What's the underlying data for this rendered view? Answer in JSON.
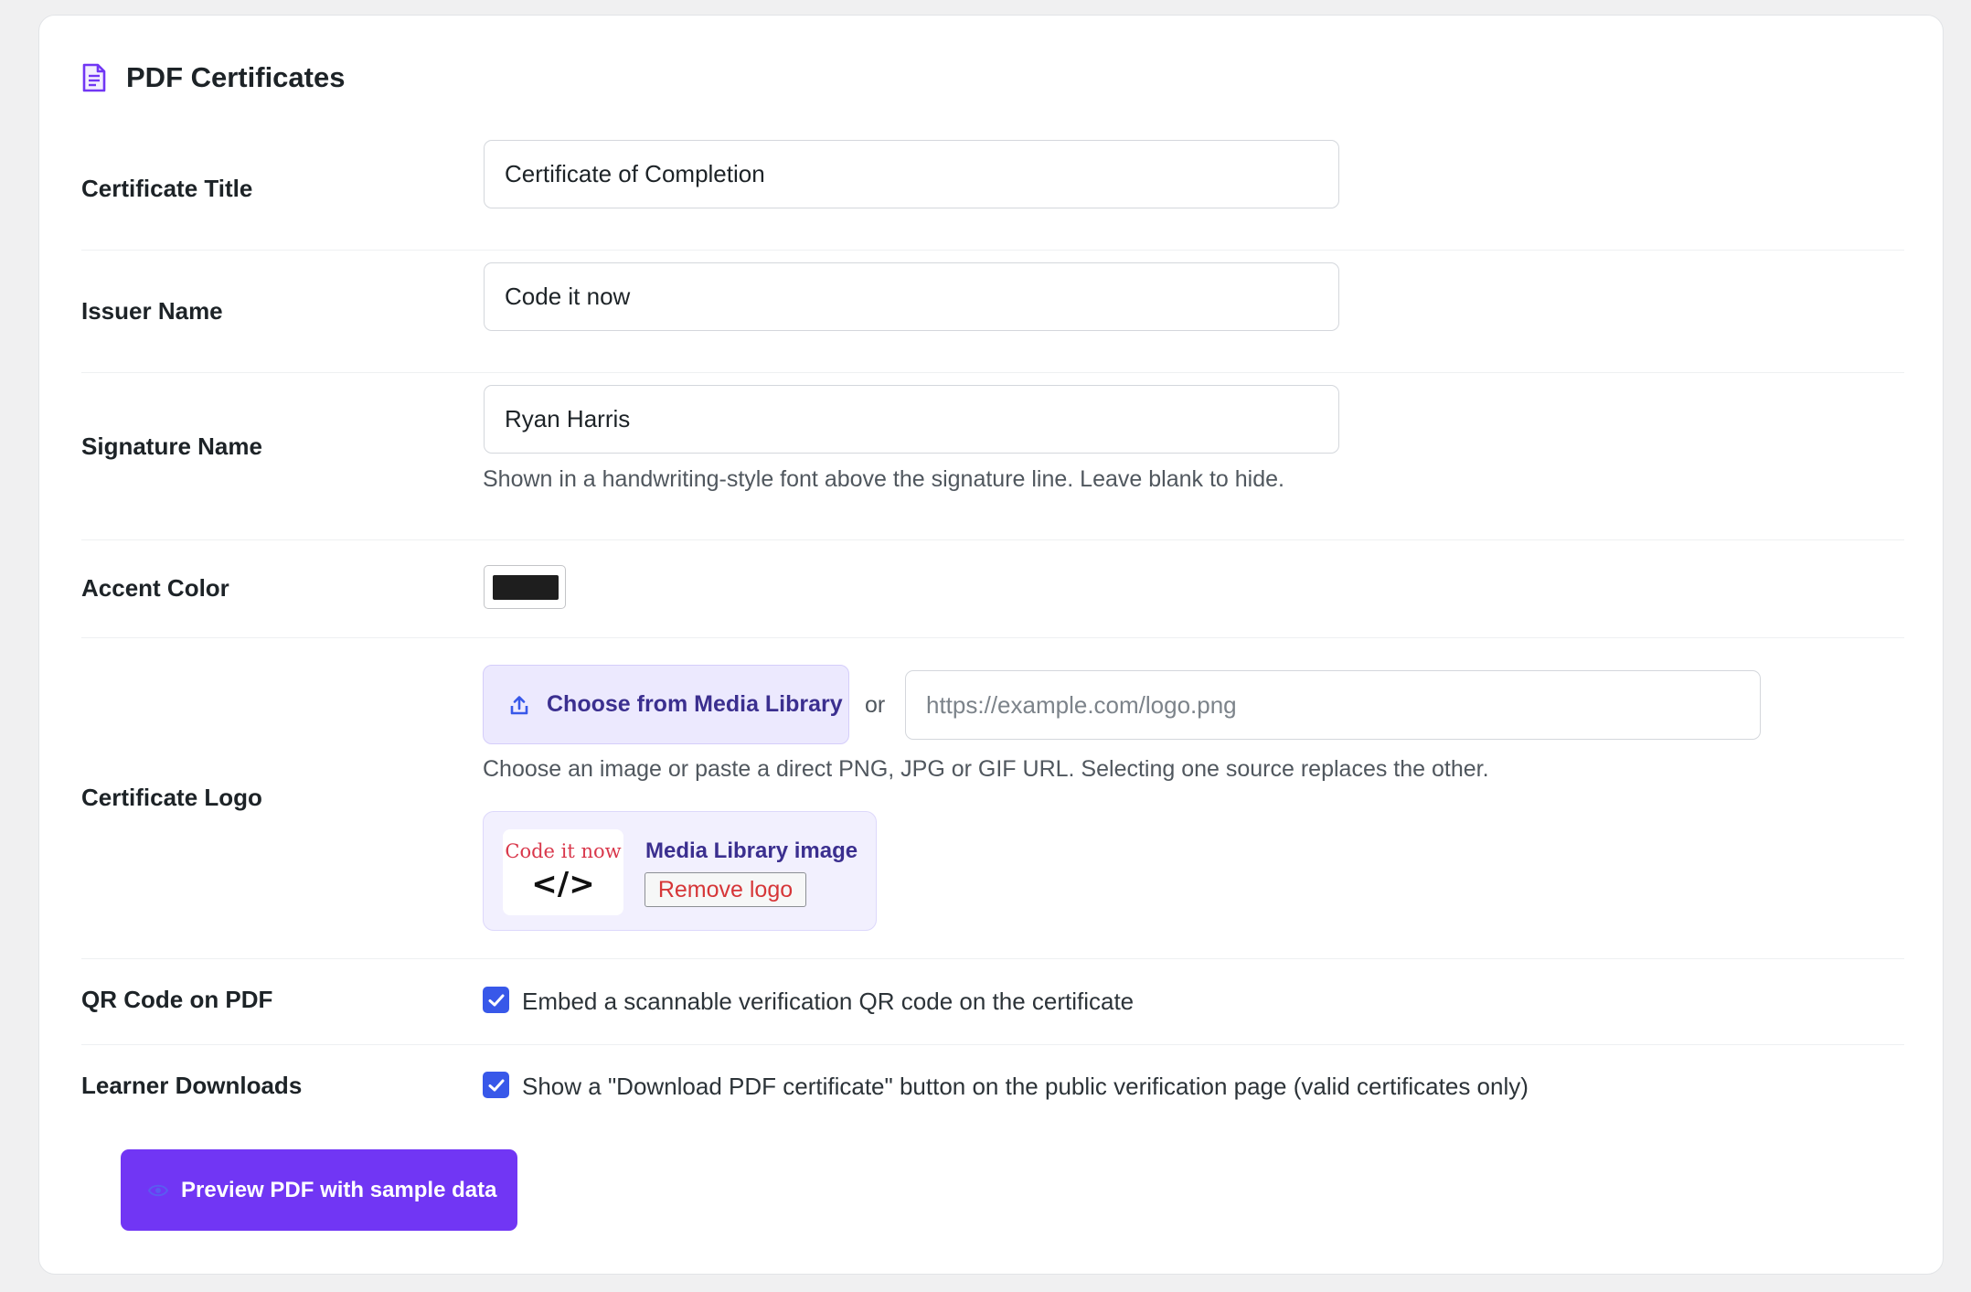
{
  "section": {
    "title": "PDF Certificates",
    "icon": "document-icon"
  },
  "certificate_title": {
    "label": "Certificate Title",
    "value": "Certificate of Completion"
  },
  "issuer_name": {
    "label": "Issuer Name",
    "value": "Code it now"
  },
  "signature_name": {
    "label": "Signature Name",
    "value": "Ryan Harris",
    "help": "Shown in a handwriting-style font above the signature line. Leave blank to hide."
  },
  "accent_color": {
    "label": "Accent Color",
    "value": "#1e1e1e"
  },
  "certificate_logo": {
    "label": "Certificate Logo",
    "media_button_label": "Choose from Media Library",
    "media_button_icon": "upload-icon",
    "or_text": "or",
    "url_placeholder": "https://example.com/logo.png",
    "url_value": "",
    "help": "Choose an image or paste a direct PNG, JPG or GIF URL. Selecting one source replaces the other.",
    "preview": {
      "logo_text": "Code it now",
      "logo_symbol": "</>",
      "source_label": "Media Library image",
      "remove_label": "Remove logo"
    }
  },
  "qr_code": {
    "label": "QR Code on PDF",
    "checked": true,
    "text": "Embed a scannable verification QR code on the certificate"
  },
  "learner_downloads": {
    "label": "Learner Downloads",
    "checked": true,
    "text": "Show a \"Download PDF certificate\" button on the public verification page (valid certificates only)"
  },
  "preview_button": {
    "label": "Preview PDF with sample data",
    "icon": "eye-icon"
  },
  "colors": {
    "brand_purple": "#7136f4",
    "checkbox_blue": "#3858e9",
    "danger_red": "#d63638",
    "media_tint": "#ece9fe"
  }
}
